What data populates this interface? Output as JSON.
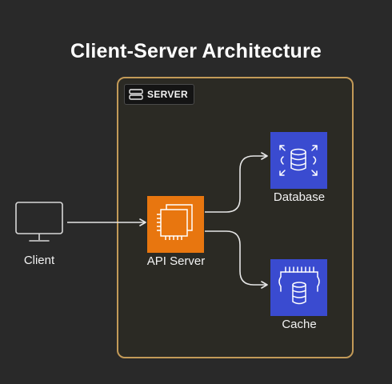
{
  "title": "Client-Server Architecture",
  "group": {
    "label": "SERVER",
    "icon": "server-icon",
    "border_color": "#c39a58"
  },
  "nodes": {
    "client": {
      "label": "Client",
      "icon": "monitor-icon"
    },
    "api_server": {
      "label": "API Server",
      "icon": "ec2-chip-icon",
      "color": "#e8760f"
    },
    "database": {
      "label": "Database",
      "icon": "database-icon",
      "color": "#3a4bd0"
    },
    "cache": {
      "label": "Cache",
      "icon": "cache-memory-icon",
      "color": "#3a4bd0"
    }
  },
  "edges": [
    {
      "from": "Client",
      "to": "API Server"
    },
    {
      "from": "API Server",
      "to": "Database"
    },
    {
      "from": "API Server",
      "to": "Cache"
    }
  ],
  "colors": {
    "background": "#292929",
    "group_fill": "#2b2a24",
    "edge": "#e6e6e6"
  }
}
